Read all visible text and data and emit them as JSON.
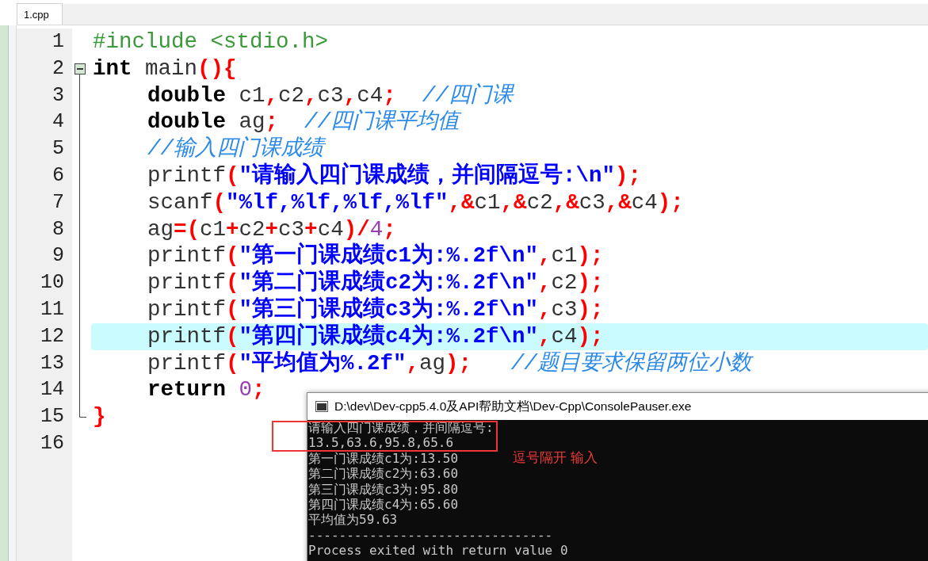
{
  "tabs": [
    {
      "label": "1.cpp",
      "selected": true
    }
  ],
  "editor": {
    "lines": [
      {
        "number": "1",
        "kind": "plain",
        "highlighted": false,
        "in_block": false,
        "tokens": [
          {
            "kind": "preprocessor",
            "text": "#include <stdio.h>"
          }
        ]
      },
      {
        "number": "2",
        "kind": "fold-start",
        "highlighted": false,
        "in_block": false,
        "tokens": [
          {
            "kind": "keyword",
            "text": "int"
          },
          {
            "kind": "ident",
            "text": " main"
          },
          {
            "kind": "punct",
            "text": "(){"
          }
        ]
      },
      {
        "number": "3",
        "kind": "fold-body",
        "highlighted": false,
        "in_block": true,
        "tokens": [
          {
            "kind": "keyword",
            "text": "double"
          },
          {
            "kind": "ident",
            "text": " c1"
          },
          {
            "kind": "punct",
            "text": ","
          },
          {
            "kind": "ident",
            "text": "c2"
          },
          {
            "kind": "punct",
            "text": ","
          },
          {
            "kind": "ident",
            "text": "c3"
          },
          {
            "kind": "punct",
            "text": ","
          },
          {
            "kind": "ident",
            "text": "c4"
          },
          {
            "kind": "punct",
            "text": ";"
          },
          {
            "kind": "comment",
            "text": "  //四门课"
          }
        ]
      },
      {
        "number": "4",
        "kind": "fold-body",
        "highlighted": false,
        "in_block": true,
        "tokens": [
          {
            "kind": "keyword",
            "text": "double"
          },
          {
            "kind": "ident",
            "text": " ag"
          },
          {
            "kind": "punct",
            "text": ";"
          },
          {
            "kind": "comment",
            "text": "  //四门课平均值"
          }
        ]
      },
      {
        "number": "5",
        "kind": "fold-body",
        "highlighted": false,
        "in_block": true,
        "tokens": [
          {
            "kind": "comment",
            "text": "//输入四门课成绩"
          }
        ]
      },
      {
        "number": "6",
        "kind": "fold-body",
        "highlighted": false,
        "in_block": true,
        "tokens": [
          {
            "kind": "ident",
            "text": "printf"
          },
          {
            "kind": "punct",
            "text": "("
          },
          {
            "kind": "string",
            "text": "\"请输入四门课成绩，并间隔逗号:\\n\""
          },
          {
            "kind": "punct",
            "text": ");"
          }
        ]
      },
      {
        "number": "7",
        "kind": "fold-body",
        "highlighted": false,
        "in_block": true,
        "tokens": [
          {
            "kind": "ident",
            "text": "scanf"
          },
          {
            "kind": "punct",
            "text": "("
          },
          {
            "kind": "string",
            "text": "\"%lf,%lf,%lf,%lf\""
          },
          {
            "kind": "punct",
            "text": ",&"
          },
          {
            "kind": "ident",
            "text": "c1"
          },
          {
            "kind": "punct",
            "text": ",&"
          },
          {
            "kind": "ident",
            "text": "c2"
          },
          {
            "kind": "punct",
            "text": ",&"
          },
          {
            "kind": "ident",
            "text": "c3"
          },
          {
            "kind": "punct",
            "text": ",&"
          },
          {
            "kind": "ident",
            "text": "c4"
          },
          {
            "kind": "punct",
            "text": ");"
          }
        ]
      },
      {
        "number": "8",
        "kind": "fold-body",
        "highlighted": false,
        "in_block": true,
        "tokens": [
          {
            "kind": "ident",
            "text": "ag"
          },
          {
            "kind": "punct",
            "text": "=("
          },
          {
            "kind": "ident",
            "text": "c1"
          },
          {
            "kind": "punct",
            "text": "+"
          },
          {
            "kind": "ident",
            "text": "c2"
          },
          {
            "kind": "punct",
            "text": "+"
          },
          {
            "kind": "ident",
            "text": "c3"
          },
          {
            "kind": "punct",
            "text": "+"
          },
          {
            "kind": "ident",
            "text": "c4"
          },
          {
            "kind": "punct",
            "text": ")/"
          },
          {
            "kind": "number",
            "text": "4"
          },
          {
            "kind": "punct",
            "text": ";"
          }
        ]
      },
      {
        "number": "9",
        "kind": "fold-body",
        "highlighted": false,
        "in_block": true,
        "tokens": [
          {
            "kind": "ident",
            "text": "printf"
          },
          {
            "kind": "punct",
            "text": "("
          },
          {
            "kind": "string",
            "text": "\"第一门课成绩c1为:%.2f\\n\""
          },
          {
            "kind": "punct",
            "text": ","
          },
          {
            "kind": "ident",
            "text": "c1"
          },
          {
            "kind": "punct",
            "text": ");"
          }
        ]
      },
      {
        "number": "10",
        "kind": "fold-body",
        "highlighted": false,
        "in_block": true,
        "tokens": [
          {
            "kind": "ident",
            "text": "printf"
          },
          {
            "kind": "punct",
            "text": "("
          },
          {
            "kind": "string",
            "text": "\"第二门课成绩c2为:%.2f\\n\""
          },
          {
            "kind": "punct",
            "text": ","
          },
          {
            "kind": "ident",
            "text": "c2"
          },
          {
            "kind": "punct",
            "text": ");"
          }
        ]
      },
      {
        "number": "11",
        "kind": "fold-body",
        "highlighted": false,
        "in_block": true,
        "tokens": [
          {
            "kind": "ident",
            "text": "printf"
          },
          {
            "kind": "punct",
            "text": "("
          },
          {
            "kind": "string",
            "text": "\"第三门课成绩c3为:%.2f\\n\""
          },
          {
            "kind": "punct",
            "text": ","
          },
          {
            "kind": "ident",
            "text": "c3"
          },
          {
            "kind": "punct",
            "text": ");"
          }
        ]
      },
      {
        "number": "12",
        "kind": "fold-body",
        "highlighted": true,
        "in_block": true,
        "tokens": [
          {
            "kind": "ident",
            "text": "printf"
          },
          {
            "kind": "punct",
            "text": "("
          },
          {
            "kind": "string",
            "text": "\"第四门课成绩c4为:%.2f\\n\""
          },
          {
            "kind": "punct",
            "text": ","
          },
          {
            "kind": "ident",
            "text": "c4"
          },
          {
            "kind": "punct",
            "text": ");"
          }
        ]
      },
      {
        "number": "13",
        "kind": "fold-body",
        "highlighted": false,
        "in_block": true,
        "tokens": [
          {
            "kind": "ident",
            "text": "printf"
          },
          {
            "kind": "punct",
            "text": "("
          },
          {
            "kind": "string",
            "text": "\"平均值为%.2f\""
          },
          {
            "kind": "punct",
            "text": ","
          },
          {
            "kind": "ident",
            "text": "ag"
          },
          {
            "kind": "punct",
            "text": ");"
          },
          {
            "kind": "comment",
            "text": "   //题目要求保留两位小数"
          }
        ]
      },
      {
        "number": "14",
        "kind": "fold-body",
        "highlighted": false,
        "in_block": true,
        "tokens": [
          {
            "kind": "keyword",
            "text": "return"
          },
          {
            "kind": "number",
            "text": " 0"
          },
          {
            "kind": "punct",
            "text": ";"
          }
        ]
      },
      {
        "number": "15",
        "kind": "fold-end",
        "highlighted": false,
        "in_block": false,
        "tokens": [
          {
            "kind": "punct",
            "text": "}"
          }
        ]
      },
      {
        "number": "16",
        "kind": "plain",
        "highlighted": false
      }
    ]
  },
  "console": {
    "title": "D:\\dev\\Dev-cpp5.4.0及API帮助文档\\Dev-Cpp\\ConsolePauser.exe",
    "lines": [
      "请输入四门课成绩，并间隔逗号:",
      "13.5,63.6,95.8,65.6",
      "第一门课成绩c1为:13.50",
      "第二门课成绩c2为:63.60",
      "第三门课成绩c3为:95.80",
      "第四门课成绩c4为:65.60",
      "平均值为59.63",
      "--------------------------------",
      "Process exited with return value 0"
    ]
  },
  "annotation": {
    "text": "逗号隔开 输入"
  }
}
